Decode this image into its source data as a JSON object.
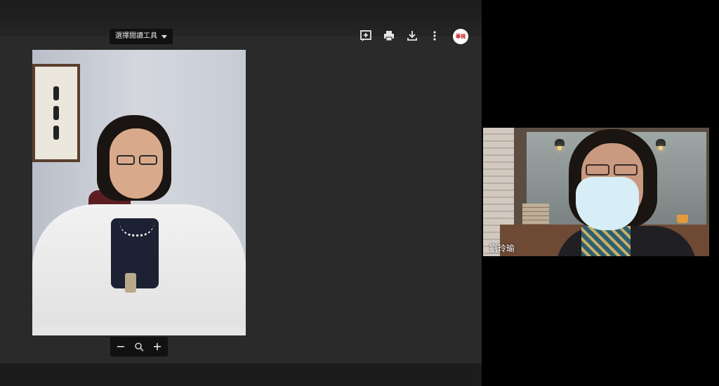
{
  "toolbar": {
    "tool_select_label": "選擇閱讀工具",
    "icons": [
      "add-comment-icon",
      "print-icon",
      "download-icon",
      "more-vert-icon"
    ],
    "profile_text": "華視"
  },
  "zoom": {
    "minus": "−",
    "reset_icon": "zoom-icon",
    "plus": "+"
  },
  "side_participant": {
    "name": "劉玲瑜"
  },
  "colors": {
    "viewer_bg": "#2a2a2a",
    "outer_bg": "#000000",
    "profile_brand": "#c4161c"
  }
}
